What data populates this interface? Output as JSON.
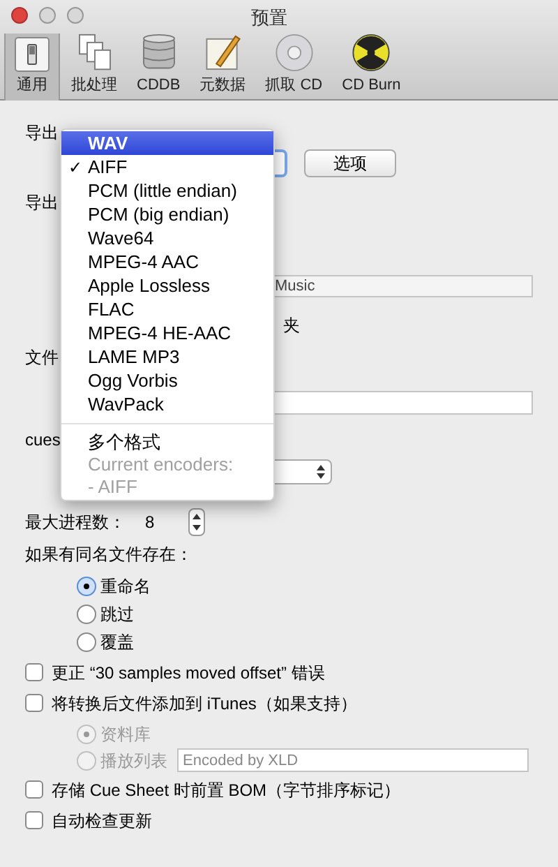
{
  "window": {
    "title": "预置"
  },
  "toolbar": [
    {
      "label": "通用",
      "selected": true
    },
    {
      "label": "批处理",
      "selected": false
    },
    {
      "label": "CDDB",
      "selected": false
    },
    {
      "label": "元数据",
      "selected": false
    },
    {
      "label": "抓取 CD",
      "selected": false
    },
    {
      "label": "CD Burn",
      "selected": false
    }
  ],
  "form": {
    "label_1": "导出",
    "options_button": "选项",
    "label_2": "导出",
    "folder_field": "Music",
    "label_3": "夹",
    "label_4": "文件",
    "label_5": "cues",
    "max_processes_label": "最大进程数：",
    "max_processes_value": "8",
    "conflict_label": "如果有同名文件存在：",
    "conflict_options": [
      {
        "label": "重命名",
        "selected": true
      },
      {
        "label": "跳过",
        "selected": false
      },
      {
        "label": "覆盖",
        "selected": false
      }
    ],
    "fix_offset": {
      "label": "更正 “30 samples moved offset” 错误",
      "checked": false
    },
    "add_itunes": {
      "label": "将转换后文件添加到 iTunes（如果支持）",
      "checked": false
    },
    "itunes_targets": [
      {
        "label": "资料库",
        "selected": true,
        "disabled": true
      },
      {
        "label": "播放列表",
        "selected": false,
        "disabled": true
      }
    ],
    "playlist_field": {
      "placeholder": "Encoded by XLD"
    },
    "bom": {
      "label": "存储 Cue Sheet 时前置 BOM（字节排序标记）",
      "checked": false
    },
    "auto_update": {
      "label": "自动检查更新",
      "checked": false
    }
  },
  "format_menu": {
    "formats": [
      {
        "label": "WAV",
        "highlighted": true,
        "checked": false
      },
      {
        "label": "AIFF",
        "highlighted": false,
        "checked": true
      },
      {
        "label": "PCM (little endian)",
        "highlighted": false,
        "checked": false
      },
      {
        "label": "PCM (big endian)",
        "highlighted": false,
        "checked": false
      },
      {
        "label": "Wave64",
        "highlighted": false,
        "checked": false
      },
      {
        "label": "MPEG-4 AAC",
        "highlighted": false,
        "checked": false
      },
      {
        "label": "Apple Lossless",
        "highlighted": false,
        "checked": false
      },
      {
        "label": "FLAC",
        "highlighted": false,
        "checked": false
      },
      {
        "label": "MPEG-4 HE-AAC",
        "highlighted": false,
        "checked": false
      },
      {
        "label": "LAME MP3",
        "highlighted": false,
        "checked": false
      },
      {
        "label": "Ogg Vorbis",
        "highlighted": false,
        "checked": false
      },
      {
        "label": "WavPack",
        "highlighted": false,
        "checked": false
      }
    ],
    "extra": [
      {
        "label": "多个格式",
        "disabled": false
      },
      {
        "label": "Current encoders:",
        "disabled": true
      },
      {
        "label": "- AIFF",
        "disabled": true
      }
    ],
    "check_mark": "✓"
  }
}
